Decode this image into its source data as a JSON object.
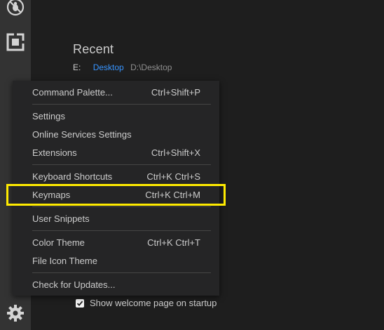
{
  "activity_bar": {
    "icons": [
      "debug-icon",
      "extensions-icon",
      "gear-icon"
    ]
  },
  "welcome": {
    "recent_title": "Recent",
    "recent_items": [
      {
        "drive": "E:",
        "name": "Desktop",
        "path": "D:\\Desktop"
      }
    ],
    "show_on_startup_label": "Show welcome page on startup",
    "show_on_startup_checked": true
  },
  "menu": {
    "groups": [
      [
        {
          "label": "Command Palette...",
          "shortcut": "Ctrl+Shift+P"
        }
      ],
      [
        {
          "label": "Settings",
          "shortcut": ""
        },
        {
          "label": "Online Services Settings",
          "shortcut": ""
        },
        {
          "label": "Extensions",
          "shortcut": "Ctrl+Shift+X"
        }
      ],
      [
        {
          "label": "Keyboard Shortcuts",
          "shortcut": "Ctrl+K Ctrl+S"
        },
        {
          "label": "Keymaps",
          "shortcut": "Ctrl+K Ctrl+M"
        }
      ],
      [
        {
          "label": "User Snippets",
          "shortcut": ""
        }
      ],
      [
        {
          "label": "Color Theme",
          "shortcut": "Ctrl+K Ctrl+T"
        },
        {
          "label": "File Icon Theme",
          "shortcut": ""
        }
      ],
      [
        {
          "label": "Check for Updates...",
          "shortcut": ""
        }
      ]
    ],
    "highlighted_item": "Keymaps"
  },
  "colors": {
    "highlight_border": "#ffeb00",
    "link": "#3794ff",
    "menu_bg": "#252526",
    "editor_bg": "#1e1e1e",
    "activity_bar_bg": "#333333"
  }
}
